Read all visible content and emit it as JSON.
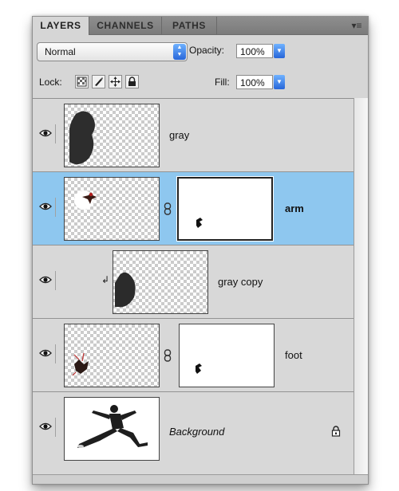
{
  "tabs": [
    {
      "label": "LAYERS",
      "active": true
    },
    {
      "label": "CHANNELS",
      "active": false
    },
    {
      "label": "PATHS",
      "active": false
    }
  ],
  "panel_menu_icon": "panel-menu-icon",
  "options": {
    "blend_mode": "Normal",
    "opacity_label": "Opacity:",
    "opacity_value": "100%",
    "lock_label": "Lock:",
    "fill_label": "Fill:",
    "fill_value": "100%"
  },
  "layers": [
    {
      "name": "gray",
      "visible": true,
      "selected": false,
      "has_mask": false,
      "clipped": false,
      "style": "normal"
    },
    {
      "name": "arm",
      "visible": true,
      "selected": true,
      "has_mask": true,
      "clipped": false,
      "style": "bold"
    },
    {
      "name": "gray copy",
      "visible": true,
      "selected": false,
      "has_mask": false,
      "clipped": true,
      "style": "normal"
    },
    {
      "name": "foot",
      "visible": true,
      "selected": false,
      "has_mask": true,
      "clipped": false,
      "style": "normal"
    },
    {
      "name": "Background",
      "visible": true,
      "selected": false,
      "has_mask": false,
      "clipped": false,
      "style": "italic",
      "locked": true
    }
  ],
  "colors": {
    "selection": "#8ec7ef",
    "accent_blue": "#2766d9"
  }
}
